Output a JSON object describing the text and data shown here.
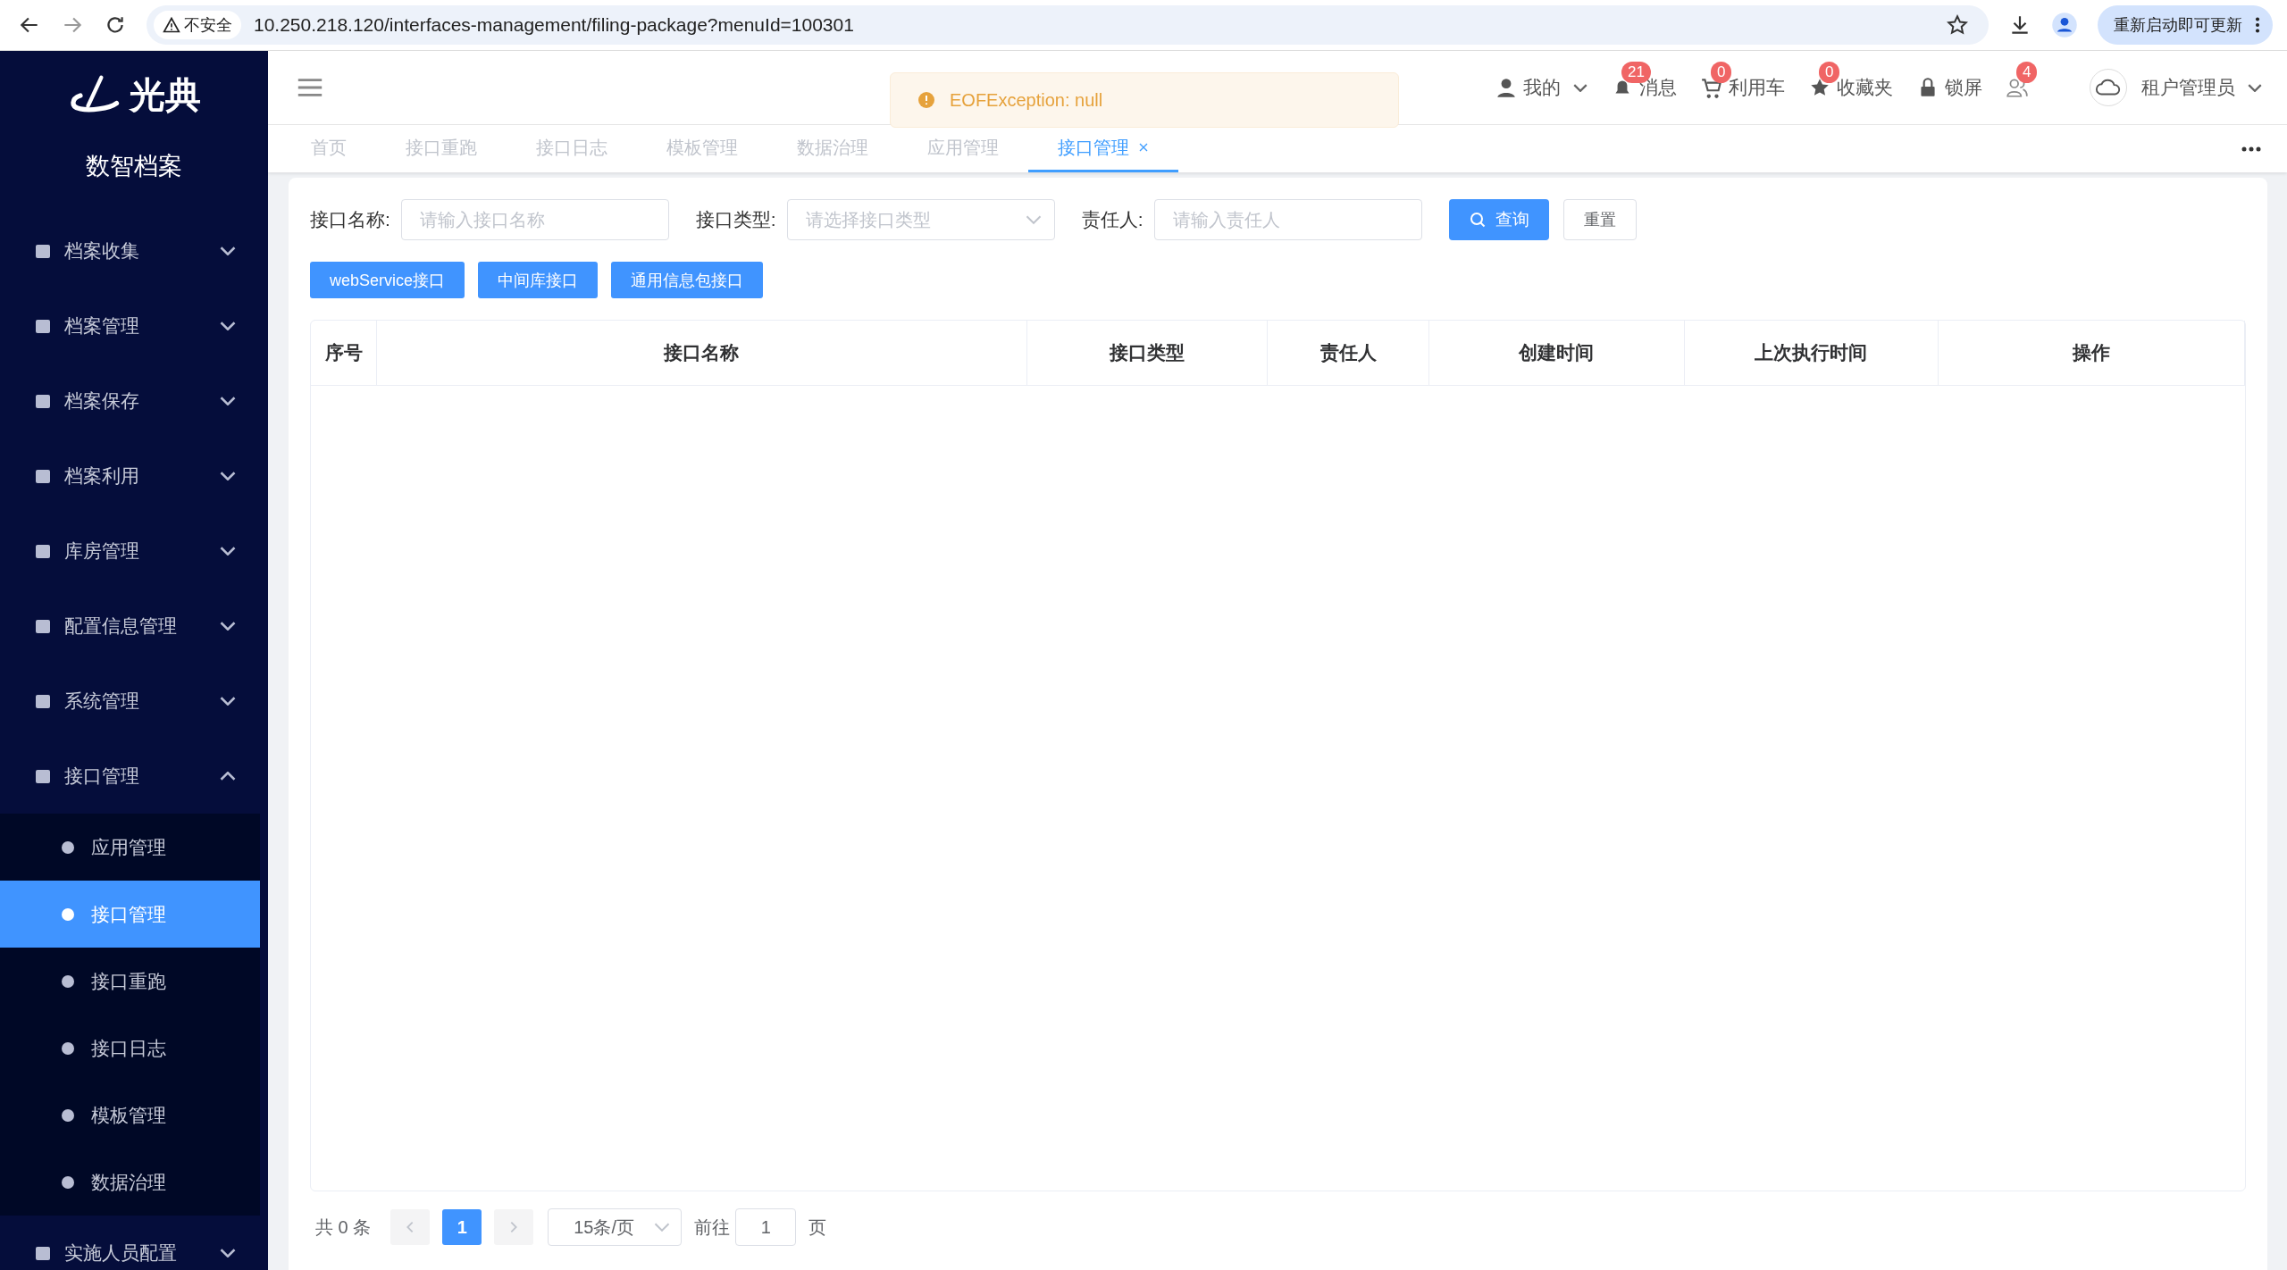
{
  "browser": {
    "security_label": "不安全",
    "url": "10.250.218.120/interfaces-management/filing-package?menuId=100301",
    "update_button": "重新启动即可更新"
  },
  "sidebar": {
    "logo_text": "光典",
    "app_name": "数智档案",
    "items": [
      {
        "label": "档案收集",
        "expanded": false
      },
      {
        "label": "档案管理",
        "expanded": false
      },
      {
        "label": "档案保存",
        "expanded": false
      },
      {
        "label": "档案利用",
        "expanded": false
      },
      {
        "label": "库房管理",
        "expanded": false
      },
      {
        "label": "配置信息管理",
        "expanded": false
      },
      {
        "label": "系统管理",
        "expanded": false
      },
      {
        "label": "接口管理",
        "expanded": true,
        "children": [
          {
            "label": "应用管理",
            "selected": false
          },
          {
            "label": "接口管理",
            "selected": true
          },
          {
            "label": "接口重跑",
            "selected": false
          },
          {
            "label": "接口日志",
            "selected": false
          },
          {
            "label": "模板管理",
            "selected": false
          },
          {
            "label": "数据治理",
            "selected": false
          }
        ]
      },
      {
        "label": "实施人员配置",
        "expanded": false
      }
    ]
  },
  "header": {
    "user_menu": "我的",
    "actions": [
      {
        "label": "消息",
        "badge": "21"
      },
      {
        "label": "利用车",
        "badge": "0"
      },
      {
        "label": "收藏夹",
        "badge": "0"
      },
      {
        "label": "锁屏"
      },
      {
        "badge": "4"
      }
    ],
    "account": "租户管理员"
  },
  "toast": {
    "kind": "warning",
    "message": "EOFException: null"
  },
  "tabs": [
    {
      "label": "首页",
      "selected": false
    },
    {
      "label": "接口重跑",
      "selected": false
    },
    {
      "label": "接口日志",
      "selected": false
    },
    {
      "label": "模板管理",
      "selected": false
    },
    {
      "label": "数据治理",
      "selected": false
    },
    {
      "label": "应用管理",
      "selected": false
    },
    {
      "label": "接口管理",
      "selected": true
    }
  ],
  "filters": [
    {
      "label": "接口名称:",
      "kind": "input",
      "placeholder": "请输入接口名称"
    },
    {
      "label": "接口类型:",
      "kind": "select",
      "placeholder": "请选择接口类型"
    },
    {
      "label": "责任人:",
      "kind": "input",
      "placeholder": "请输入责任人"
    }
  ],
  "search_button": "查询",
  "reset_button": "重置",
  "action_buttons": [
    "webService接口",
    "中间库接口",
    "通用信息包接口"
  ],
  "table": {
    "columns": [
      "序号",
      "接口名称",
      "接口类型",
      "责任人",
      "创建时间",
      "上次执行时间",
      "操作"
    ]
  },
  "pagination": {
    "total": "共 0 条",
    "pages": [
      {
        "label": "1",
        "selected": true
      }
    ],
    "page_size": "15条/页",
    "goto_label": "前往",
    "goto_value": "1",
    "goto_suffix": "页"
  }
}
